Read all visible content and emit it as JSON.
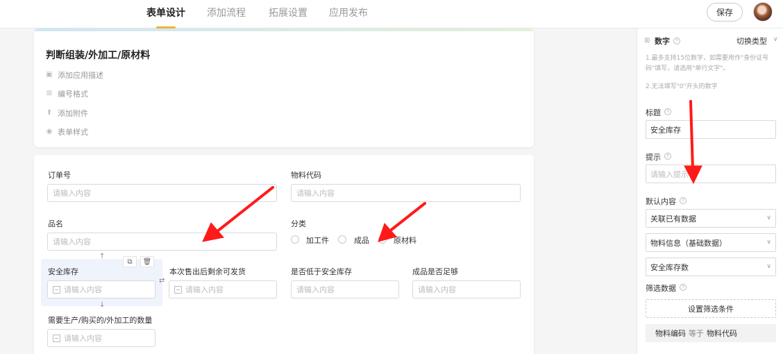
{
  "header": {
    "tabs": [
      {
        "label": "表单设计",
        "active": true
      },
      {
        "label": "添加流程",
        "active": false
      },
      {
        "label": "拓展设置",
        "active": false
      },
      {
        "label": "应用发布",
        "active": false
      }
    ],
    "save_label": "保存",
    "accent_color": "#f2b33a"
  },
  "form_header": {
    "title": "判断组装/外加工/原材料",
    "meta": [
      {
        "icon": "description-icon",
        "label": "添加应用描述"
      },
      {
        "icon": "number-format-icon",
        "label": "编号格式"
      },
      {
        "icon": "upload-icon",
        "label": "添加附件"
      },
      {
        "icon": "style-icon",
        "label": "表单样式"
      }
    ]
  },
  "fields": {
    "order_no": {
      "label": "订单号",
      "placeholder": "请输入内容"
    },
    "material_code": {
      "label": "物料代码",
      "placeholder": "请输入内容"
    },
    "product_name": {
      "label": "品名",
      "placeholder": "请输入内容"
    },
    "category": {
      "label": "分类",
      "options": [
        "加工件",
        "成品",
        "原材料"
      ]
    },
    "safety_stock": {
      "label": "安全库存",
      "placeholder": "请输入内容"
    },
    "remaining": {
      "label": "本次售出后剩余可发货",
      "placeholder": "请输入内容"
    },
    "below_safety": {
      "label": "是否低于安全库存",
      "placeholder": "请输入内容"
    },
    "sufficient": {
      "label": "成品是否足够",
      "placeholder": "请输入内容"
    },
    "quantity_needed": {
      "label": "需要生产/购买的/外加工的数量",
      "placeholder": "请输入内容"
    }
  },
  "panel": {
    "type_title": "数字",
    "switch_type": "切换类型",
    "hints": [
      "1.最多支持15位数字，如需要用作\"身份证号码\"填写，请选用\"单行文字\"。",
      "2.无法填写\"0\"开头的数字"
    ],
    "title_label": "标题",
    "title_value": "安全库存",
    "prompt_label": "提示",
    "prompt_placeholder": "请输入提示",
    "default_label": "默认内容",
    "default_select": "关联已有数据",
    "source_select": "物料信息（基础数据）",
    "field_select": "安全库存数",
    "filter_label": "筛选数据",
    "filter_button": "设置筛选条件",
    "filter_rule": {
      "left": "物料编码",
      "op": "等于",
      "right": "物料代码"
    }
  },
  "annotation_color": "#ff1a1a"
}
